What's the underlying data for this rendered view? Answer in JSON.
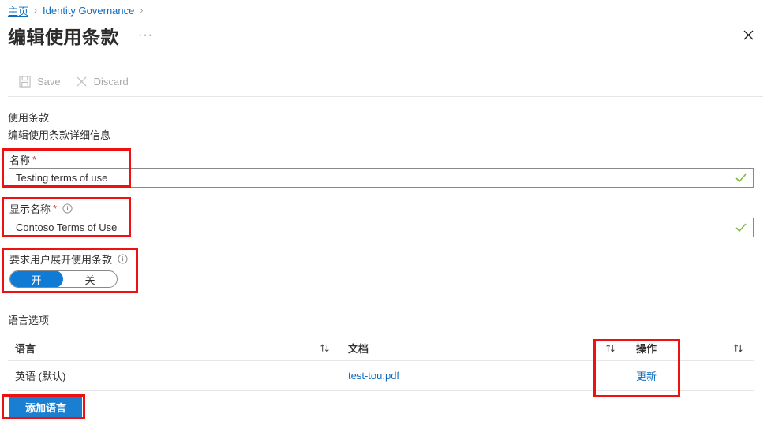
{
  "breadcrumb": {
    "items": [
      {
        "label": "主页",
        "underlined": true
      },
      {
        "label": "Identity Governance",
        "underlined": false
      }
    ],
    "separator": "›"
  },
  "header": {
    "title": "编辑使用条款",
    "ellipsis": "···",
    "close_icon": "close-icon"
  },
  "commandbar": {
    "save": {
      "label": "Save",
      "icon": "save-icon",
      "disabled": true
    },
    "discard": {
      "label": "Discard",
      "icon": "discard-icon",
      "disabled": true
    }
  },
  "section": {
    "heading": "使用条款",
    "subheading": "编辑使用条款详细信息"
  },
  "fields": {
    "name": {
      "label": "名称",
      "required_marker": "*",
      "value": "Testing terms of use",
      "placeholder": "",
      "valid": true
    },
    "display_name": {
      "label": "显示名称",
      "required_marker": "*",
      "info_icon": "info-icon",
      "value": "Contoso Terms of Use",
      "placeholder": "",
      "valid": true
    },
    "require_expand": {
      "label": "要求用户展开使用条款",
      "info_icon": "info-icon",
      "on_label": "开",
      "off_label": "关",
      "selected": "开"
    }
  },
  "language_options": {
    "heading": "语言选项",
    "columns": [
      "语言",
      "文档",
      "操作"
    ],
    "sort_icon": "sort-ascending-descending-icon",
    "rows": [
      {
        "language": "英语 (默认)",
        "document": "test-tou.pdf",
        "action": "更新"
      }
    ],
    "add_button": "添加语言"
  },
  "colors": {
    "link": "#0f6cbd",
    "primary_button": "#1a7ed1",
    "toggle_on": "#0f7bd4",
    "required_star": "#d13438",
    "valid_check": "#7cbb42",
    "annotation": "#ee1111"
  }
}
